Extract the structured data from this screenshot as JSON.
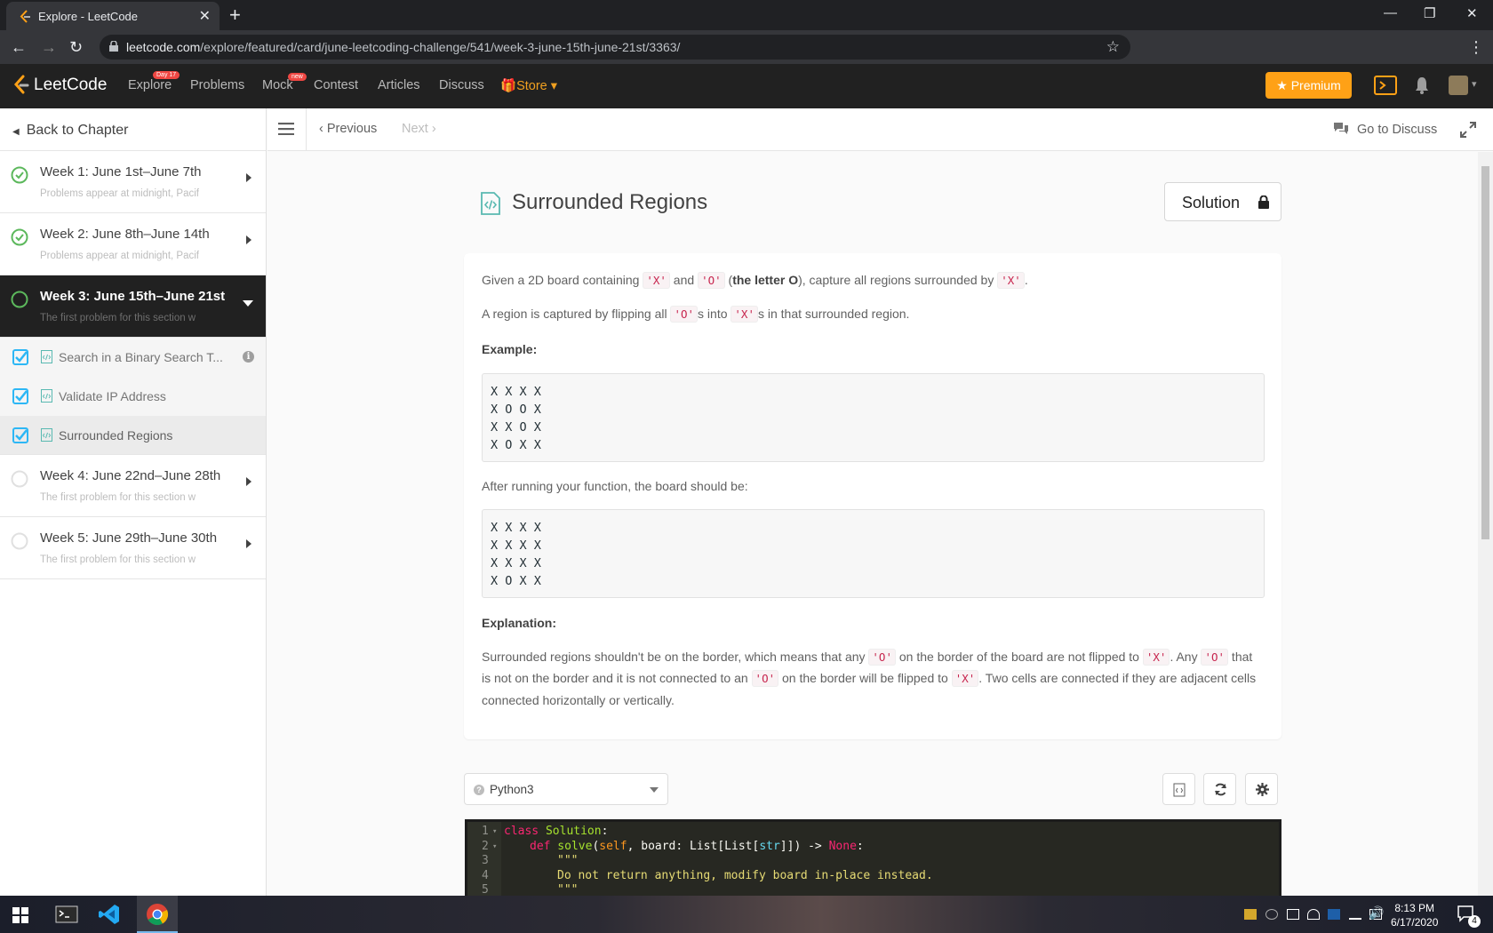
{
  "browser": {
    "tab_title": "Explore - LeetCode",
    "url_host": "leetcode.com",
    "url_path": "/explore/featured/card/june-leetcoding-challenge/541/week-3-june-15th-june-21st/3363/"
  },
  "nav": {
    "logo": "LeetCode",
    "links": [
      {
        "label": "Explore",
        "badge": "Day 17"
      },
      {
        "label": "Problems"
      },
      {
        "label": "Mock",
        "badge": "new"
      },
      {
        "label": "Contest"
      },
      {
        "label": "Articles"
      },
      {
        "label": "Discuss"
      },
      {
        "label": "Store"
      }
    ],
    "premium": "Premium"
  },
  "sidebar": {
    "back": "Back to Chapter",
    "chapters": [
      {
        "title": "Week 1: June 1st–June 7th",
        "subtitle": "Problems appear at midnight, Pacif",
        "status": "complete"
      },
      {
        "title": "Week 2: June 8th–June 14th",
        "subtitle": "Problems appear at midnight, Pacif",
        "status": "complete"
      },
      {
        "title": "Week 3: June 15th–June 21st",
        "subtitle": "The first problem for this section w",
        "status": "in-progress"
      },
      {
        "title": "Week 4: June 22nd–June 28th",
        "subtitle": "The first problem for this section w",
        "status": "not-started"
      },
      {
        "title": "Week 5: June 29th–June 30th",
        "subtitle": "The first problem for this section w",
        "status": "not-started"
      }
    ],
    "items": [
      {
        "label": "Search in a Binary Search T..."
      },
      {
        "label": "Validate IP Address"
      },
      {
        "label": "Surrounded Regions"
      }
    ]
  },
  "toolbar": {
    "previous": "Previous",
    "next": "Next",
    "go_to_discuss": "Go to Discuss"
  },
  "question": {
    "title": "Surrounded Regions",
    "solution_button": "Solution",
    "p1_a": "Given a 2D board containing ",
    "p1_x": "'X'",
    "p1_and": " and ",
    "p1_o": "'O'",
    "p1_b": " (",
    "p1_bold": "the letter O",
    "p1_c": "), capture all regions surrounded by ",
    "p1_x2": "'X'",
    "p1_d": ".",
    "p2_a": "A region is captured by flipping all ",
    "p2_o": "'O'",
    "p2_b": "s into ",
    "p2_x": "'X'",
    "p2_c": "s in that surrounded region.",
    "example_label": "Example:",
    "example_before": "X X X X\nX O O X\nX X O X\nX O X X",
    "after_text": "After running your function, the board should be:",
    "example_after": "X X X X\nX X X X\nX X X X\nX O X X",
    "explanation_label": "Explanation:",
    "e1_a": "Surrounded regions shouldn't be on the border, which means that any ",
    "e1_o": "'O'",
    "e1_b": " on the border of the board are not flipped to ",
    "e1_x": "'X'",
    "e1_c": ". Any ",
    "e1_o2": "'O'",
    "e1_d": " that",
    "e2_a": "is not on the border and it is not connected to an ",
    "e2_o": "'O'",
    "e2_b": " on the border will be flipped to ",
    "e2_x": "'X'",
    "e2_c": ". Two cells are connected if they are adjacent cells",
    "e3": "connected horizontally or vertically."
  },
  "editor": {
    "language": "Python3",
    "lines": [
      {
        "n": "1",
        "fold": true
      },
      {
        "n": "2",
        "fold": true
      },
      {
        "n": "3"
      },
      {
        "n": "4"
      },
      {
        "n": "5"
      }
    ],
    "code": {
      "l1_kw": "class",
      "l1_name": " Solution",
      "l1_end": ":",
      "l2_kw": "def",
      "l2_fn": " solve",
      "l2_a": "(",
      "l2_self": "self",
      "l2_b": ", board: List[List[",
      "l2_str": "str",
      "l2_c": "]]) -> ",
      "l2_none": "None",
      "l2_end": ":",
      "l3": "\"\"\"",
      "l4": "Do not return anything, modify board in-place instead.",
      "l5": "\"\"\""
    }
  },
  "taskbar": {
    "time": "8:13 PM",
    "date": "6/17/2020",
    "notifications": "4"
  },
  "colors": {
    "accent": "#ffa116",
    "complete": "#5cb85c",
    "check": "#2db7f5",
    "code_red": "#c7254e"
  }
}
